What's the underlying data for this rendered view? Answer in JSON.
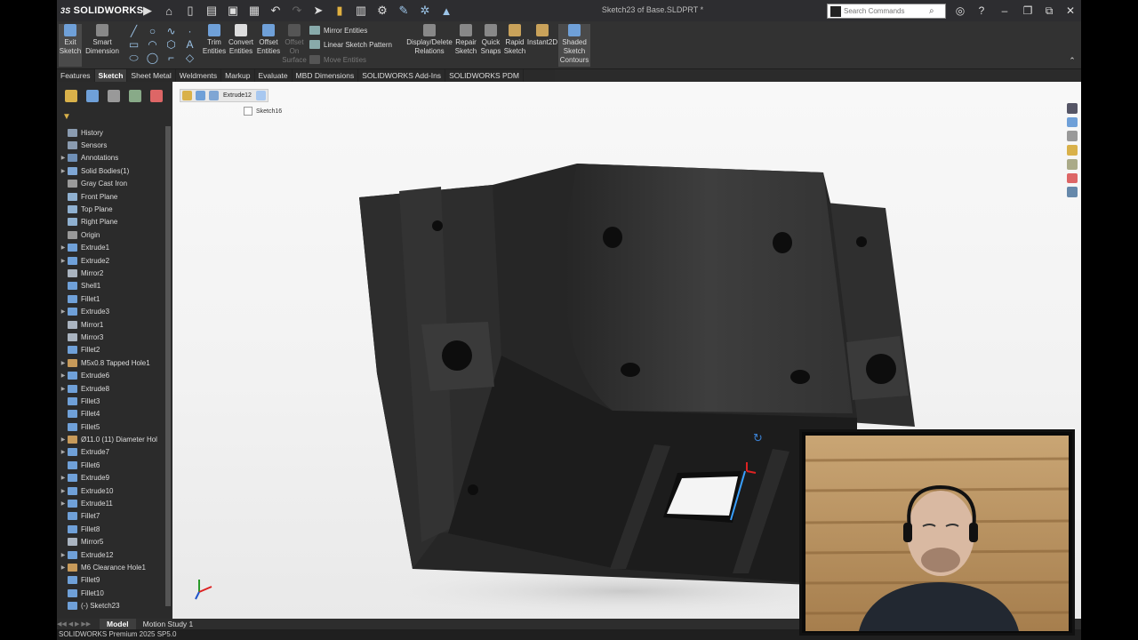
{
  "app": {
    "logo_text": "SOLIDWORKS",
    "logo_prefix": "3S",
    "doc_title": "Sketch23 of Base.SLDPRT *"
  },
  "search": {
    "placeholder": "Search Commands"
  },
  "command_manager": {
    "exit_sketch": [
      "Exit",
      "Sketch"
    ],
    "smart_dimension": [
      "Smart",
      "Dimension"
    ],
    "trim": [
      "Trim",
      "Entities"
    ],
    "convert": [
      "Convert",
      "Entities"
    ],
    "offset": [
      "Offset",
      "Entities"
    ],
    "offset_surface": [
      "Offset",
      "On",
      "Surface"
    ],
    "mirror_entities": "Mirror Entities",
    "linear_pattern": "Linear Sketch Pattern",
    "move_entities": "Move Entities",
    "display_relations": [
      "Display/Delete",
      "Relations"
    ],
    "repair_sketch": [
      "Repair",
      "Sketch"
    ],
    "quick_snaps": [
      "Quick",
      "Snaps"
    ],
    "rapid_sketch": [
      "Rapid",
      "Sketch"
    ],
    "instant2d": [
      "Instant2D"
    ],
    "shaded_contours": [
      "Shaded",
      "Sketch",
      "Contours"
    ]
  },
  "tabs": [
    "Features",
    "Sketch",
    "Sheet Metal",
    "Weldments",
    "Markup",
    "Evaluate",
    "MBD Dimensions",
    "SOLIDWORKS Add-Ins",
    "SOLIDWORKS PDM"
  ],
  "active_tab": "Sketch",
  "tree": [
    {
      "label": "History",
      "arrow": false,
      "color": "#8a9bb0"
    },
    {
      "label": "Sensors",
      "arrow": false,
      "color": "#8a9bb0"
    },
    {
      "label": "Annotations",
      "arrow": true,
      "color": "#6f8fb5"
    },
    {
      "label": "Solid Bodies(1)",
      "arrow": true,
      "color": "#7fa6d4"
    },
    {
      "label": "Gray Cast Iron",
      "arrow": false,
      "color": "#9a9a9a"
    },
    {
      "label": "Front Plane",
      "arrow": false,
      "color": "#8fb0d0"
    },
    {
      "label": "Top Plane",
      "arrow": false,
      "color": "#8fb0d0"
    },
    {
      "label": "Right Plane",
      "arrow": false,
      "color": "#8fb0d0"
    },
    {
      "label": "Origin",
      "arrow": false,
      "color": "#999"
    },
    {
      "label": "Extrude1",
      "arrow": true,
      "color": "#6fa0d8"
    },
    {
      "label": "Extrude2",
      "arrow": true,
      "color": "#6fa0d8"
    },
    {
      "label": "Mirror2",
      "arrow": false,
      "color": "#aab4c0"
    },
    {
      "label": "Shell1",
      "arrow": false,
      "color": "#6fa0d8"
    },
    {
      "label": "Fillet1",
      "arrow": false,
      "color": "#6fa0d8"
    },
    {
      "label": "Extrude3",
      "arrow": true,
      "color": "#6fa0d8"
    },
    {
      "label": "Mirror1",
      "arrow": false,
      "color": "#aab4c0"
    },
    {
      "label": "Mirror3",
      "arrow": false,
      "color": "#aab4c0"
    },
    {
      "label": "Fillet2",
      "arrow": false,
      "color": "#6fa0d8"
    },
    {
      "label": "M5x0.8 Tapped Hole1",
      "arrow": true,
      "color": "#c79a5a"
    },
    {
      "label": "Extrude6",
      "arrow": true,
      "color": "#6fa0d8"
    },
    {
      "label": "Extrude8",
      "arrow": true,
      "color": "#6fa0d8"
    },
    {
      "label": "Fillet3",
      "arrow": false,
      "color": "#6fa0d8"
    },
    {
      "label": "Fillet4",
      "arrow": false,
      "color": "#6fa0d8"
    },
    {
      "label": "Fillet5",
      "arrow": false,
      "color": "#6fa0d8"
    },
    {
      "label": "Ø11.0 (11) Diameter Hol",
      "arrow": true,
      "color": "#c79a5a"
    },
    {
      "label": "Extrude7",
      "arrow": true,
      "color": "#6fa0d8"
    },
    {
      "label": "Fillet6",
      "arrow": false,
      "color": "#6fa0d8"
    },
    {
      "label": "Extrude9",
      "arrow": true,
      "color": "#6fa0d8"
    },
    {
      "label": "Extrude10",
      "arrow": true,
      "color": "#6fa0d8"
    },
    {
      "label": "Extrude11",
      "arrow": true,
      "color": "#6fa0d8"
    },
    {
      "label": "Fillet7",
      "arrow": false,
      "color": "#6fa0d8"
    },
    {
      "label": "Fillet8",
      "arrow": false,
      "color": "#6fa0d8"
    },
    {
      "label": "Mirror5",
      "arrow": false,
      "color": "#aab4c0"
    },
    {
      "label": "Extrude12",
      "arrow": true,
      "color": "#6fa0d8"
    },
    {
      "label": "M6 Clearance Hole1",
      "arrow": true,
      "color": "#c79a5a"
    },
    {
      "label": "Fillet9",
      "arrow": false,
      "color": "#6fa0d8"
    },
    {
      "label": "Fillet10",
      "arrow": false,
      "color": "#6fa0d8"
    },
    {
      "label": "(-) Sketch23",
      "arrow": false,
      "color": "#6fa0d8"
    }
  ],
  "breadcrumb": {
    "feature": "Extrude12",
    "sketch": "Sketch16"
  },
  "bottom_tabs": [
    "Model",
    "Motion Study 1"
  ],
  "status": "SOLIDWORKS Premium 2025 SP5.0"
}
